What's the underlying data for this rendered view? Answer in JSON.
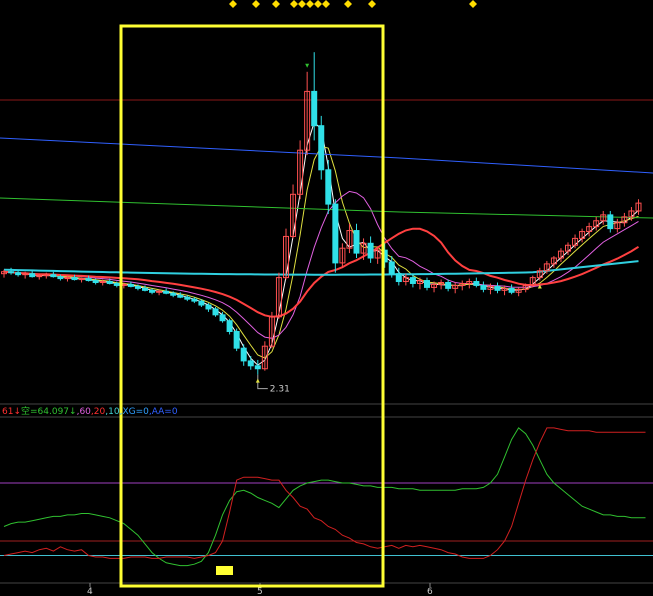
{
  "colors": {
    "background": "#000000",
    "up_candle": "#ff5050",
    "down_candle": "#30e0e8",
    "ma_fast": "#ffffff",
    "ma_mid": "#e0e040",
    "ma_slow": "#e060e0",
    "ma_long_red": "#ff4040",
    "ma_long_cyan": "#30d0e0",
    "ma_green": "#30c030",
    "ma_blue": "#3060ff",
    "highlight_box": "#ffff33",
    "grid_red": "#8a1818",
    "ind_green": "#30c030",
    "ind_red": "#d02020",
    "ind_purple_line": "#a040c0",
    "ind_red_line": "#a02020",
    "ind_cyan_line": "#40c0d0",
    "diamond": "#ffdd00"
  },
  "chart_data": [
    {
      "type": "candlestick",
      "title": "",
      "x_tick_labels": [
        "4",
        "5",
        "6"
      ],
      "low_annotation": "2.31",
      "moving_average_lines": [
        "ma-fast",
        "ma-mid",
        "ma-slow",
        "ma-long-red",
        "ma-long-cyan",
        "ma-green",
        "ma-blue"
      ],
      "candles_ohlc": [
        [
          3.34,
          3.38,
          3.3,
          3.36
        ],
        [
          3.36,
          3.4,
          3.33,
          3.35
        ],
        [
          3.35,
          3.37,
          3.31,
          3.33
        ],
        [
          3.33,
          3.36,
          3.29,
          3.34
        ],
        [
          3.34,
          3.37,
          3.3,
          3.31
        ],
        [
          3.31,
          3.34,
          3.28,
          3.32
        ],
        [
          3.32,
          3.35,
          3.29,
          3.33
        ],
        [
          3.33,
          3.36,
          3.3,
          3.31
        ],
        [
          3.31,
          3.33,
          3.27,
          3.29
        ],
        [
          3.29,
          3.32,
          3.26,
          3.3
        ],
        [
          3.3,
          3.33,
          3.27,
          3.28
        ],
        [
          3.28,
          3.3,
          3.25,
          3.29
        ],
        [
          3.29,
          3.32,
          3.26,
          3.27
        ],
        [
          3.27,
          3.29,
          3.23,
          3.25
        ],
        [
          3.25,
          3.28,
          3.22,
          3.26
        ],
        [
          3.26,
          3.29,
          3.23,
          3.24
        ],
        [
          3.24,
          3.26,
          3.2,
          3.22
        ],
        [
          3.22,
          3.25,
          3.19,
          3.23
        ],
        [
          3.23,
          3.26,
          3.2,
          3.21
        ],
        [
          3.21,
          3.23,
          3.17,
          3.19
        ],
        [
          3.19,
          3.22,
          3.16,
          3.17
        ],
        [
          3.17,
          3.19,
          3.13,
          3.15
        ],
        [
          3.15,
          3.18,
          3.12,
          3.16
        ],
        [
          3.16,
          3.19,
          3.13,
          3.14
        ],
        [
          3.14,
          3.16,
          3.1,
          3.12
        ],
        [
          3.12,
          3.15,
          3.09,
          3.1
        ],
        [
          3.1,
          3.12,
          3.06,
          3.08
        ],
        [
          3.08,
          3.1,
          3.04,
          3.06
        ],
        [
          3.06,
          3.08,
          3.0,
          3.02
        ],
        [
          3.02,
          3.04,
          2.95,
          2.98
        ],
        [
          2.98,
          3.0,
          2.9,
          2.92
        ],
        [
          2.92,
          2.95,
          2.84,
          2.86
        ],
        [
          2.86,
          2.88,
          2.72,
          2.75
        ],
        [
          2.75,
          2.78,
          2.55,
          2.58
        ],
        [
          2.58,
          2.62,
          2.4,
          2.45
        ],
        [
          2.45,
          2.5,
          2.36,
          2.4
        ],
        [
          2.4,
          2.46,
          2.31,
          2.37
        ],
        [
          2.37,
          2.65,
          2.35,
          2.6
        ],
        [
          2.6,
          2.95,
          2.58,
          2.9
        ],
        [
          2.9,
          3.35,
          2.88,
          3.3
        ],
        [
          3.3,
          3.8,
          3.28,
          3.72
        ],
        [
          3.72,
          4.25,
          3.7,
          4.15
        ],
        [
          4.15,
          4.7,
          4.1,
          4.6
        ],
        [
          4.6,
          5.4,
          4.55,
          5.2
        ],
        [
          5.2,
          5.6,
          4.7,
          4.85
        ],
        [
          4.85,
          4.95,
          4.3,
          4.4
        ],
        [
          4.4,
          4.5,
          3.95,
          4.05
        ],
        [
          4.05,
          4.1,
          3.35,
          3.45
        ],
        [
          3.45,
          3.65,
          3.4,
          3.6
        ],
        [
          3.6,
          3.85,
          3.55,
          3.78
        ],
        [
          3.78,
          3.85,
          3.5,
          3.55
        ],
        [
          3.55,
          3.7,
          3.48,
          3.65
        ],
        [
          3.65,
          3.72,
          3.45,
          3.5
        ],
        [
          3.5,
          3.62,
          3.44,
          3.58
        ],
        [
          3.58,
          3.65,
          3.4,
          3.46
        ],
        [
          3.46,
          3.52,
          3.3,
          3.34
        ],
        [
          3.34,
          3.4,
          3.22,
          3.26
        ],
        [
          3.26,
          3.34,
          3.22,
          3.3
        ],
        [
          3.3,
          3.34,
          3.2,
          3.24
        ],
        [
          3.24,
          3.3,
          3.18,
          3.27
        ],
        [
          3.27,
          3.3,
          3.17,
          3.2
        ],
        [
          3.2,
          3.26,
          3.15,
          3.23
        ],
        [
          3.23,
          3.28,
          3.18,
          3.25
        ],
        [
          3.25,
          3.28,
          3.16,
          3.19
        ],
        [
          3.19,
          3.25,
          3.14,
          3.22
        ],
        [
          3.22,
          3.27,
          3.17,
          3.24
        ],
        [
          3.24,
          3.29,
          3.19,
          3.26
        ],
        [
          3.26,
          3.3,
          3.2,
          3.22
        ],
        [
          3.22,
          3.26,
          3.15,
          3.18
        ],
        [
          3.18,
          3.24,
          3.13,
          3.21
        ],
        [
          3.21,
          3.25,
          3.14,
          3.17
        ],
        [
          3.17,
          3.22,
          3.12,
          3.19
        ],
        [
          3.19,
          3.23,
          3.13,
          3.15
        ],
        [
          3.15,
          3.2,
          3.11,
          3.18
        ],
        [
          3.18,
          3.24,
          3.15,
          3.22
        ],
        [
          3.22,
          3.32,
          3.2,
          3.3
        ],
        [
          3.3,
          3.4,
          3.27,
          3.37
        ],
        [
          3.37,
          3.47,
          3.34,
          3.44
        ],
        [
          3.44,
          3.52,
          3.4,
          3.5
        ],
        [
          3.5,
          3.6,
          3.46,
          3.57
        ],
        [
          3.57,
          3.66,
          3.53,
          3.63
        ],
        [
          3.63,
          3.74,
          3.6,
          3.7
        ],
        [
          3.7,
          3.8,
          3.66,
          3.77
        ],
        [
          3.77,
          3.86,
          3.72,
          3.82
        ],
        [
          3.82,
          3.92,
          3.78,
          3.88
        ],
        [
          3.88,
          3.98,
          3.84,
          3.94
        ],
        [
          3.94,
          3.98,
          3.76,
          3.8
        ],
        [
          3.8,
          3.9,
          3.76,
          3.86
        ],
        [
          3.86,
          3.96,
          3.82,
          3.92
        ],
        [
          3.92,
          4.02,
          3.88,
          3.98
        ],
        [
          3.98,
          4.1,
          3.94,
          4.06
        ]
      ]
    },
    {
      "type": "line",
      "title": "",
      "indicator_text": [
        {
          "text": "61",
          "color": "#ff3030"
        },
        {
          "text": "↓",
          "color": "#ff3030"
        },
        {
          "text": "空=64.097",
          "color": "#30c030"
        },
        {
          "text": "↓",
          "color": "#30c030"
        },
        {
          "text": ",60",
          "color": "#e060e0"
        },
        {
          "text": ",20",
          "color": "#ff3030"
        },
        {
          "text": ",10",
          "color": "#40d0d0"
        },
        {
          "text": ",XG=0",
          "color": "#30a0ff"
        },
        {
          "text": ",AA=0",
          "color": "#3060ff"
        }
      ],
      "reference_levels": [
        60,
        20,
        10
      ],
      "ylim": [
        0,
        100
      ],
      "series": [
        {
          "color": "#30c030",
          "values": [
            30,
            32,
            33,
            33,
            34,
            35,
            36,
            37,
            37,
            38,
            38,
            39,
            39,
            38,
            37,
            36,
            34,
            32,
            28,
            24,
            18,
            12,
            8,
            5,
            4,
            3,
            3,
            4,
            6,
            12,
            24,
            38,
            48,
            54,
            55,
            53,
            50,
            48,
            46,
            43,
            49,
            55,
            58,
            60,
            61,
            62,
            62,
            61,
            60,
            60,
            59,
            58,
            58,
            57,
            57,
            57,
            56,
            56,
            56,
            55,
            55,
            55,
            55,
            55,
            55,
            56,
            56,
            56,
            57,
            60,
            66,
            78,
            90,
            98,
            94,
            86,
            76,
            66,
            60,
            56,
            52,
            48,
            44,
            42,
            40,
            38,
            38,
            37,
            37,
            36,
            36,
            36
          ]
        },
        {
          "color": "#d02020",
          "values": [
            10,
            11,
            12,
            13,
            12,
            14,
            15,
            13,
            16,
            14,
            13,
            14,
            10,
            9,
            9,
            8,
            8,
            8,
            9,
            9,
            9,
            8,
            8,
            9,
            9,
            9,
            9,
            8,
            9,
            10,
            12,
            20,
            40,
            62,
            64,
            64,
            64,
            63,
            62,
            62,
            55,
            50,
            44,
            42,
            36,
            34,
            30,
            28,
            24,
            22,
            19,
            18,
            16,
            15,
            16,
            17,
            15,
            17,
            16,
            17,
            16,
            15,
            14,
            12,
            11,
            9,
            8,
            8,
            8,
            10,
            14,
            20,
            30,
            46,
            62,
            76,
            88,
            98,
            98,
            97,
            96,
            96,
            96,
            96,
            95,
            95,
            95,
            95,
            95,
            95,
            95,
            95
          ]
        }
      ]
    }
  ]
}
